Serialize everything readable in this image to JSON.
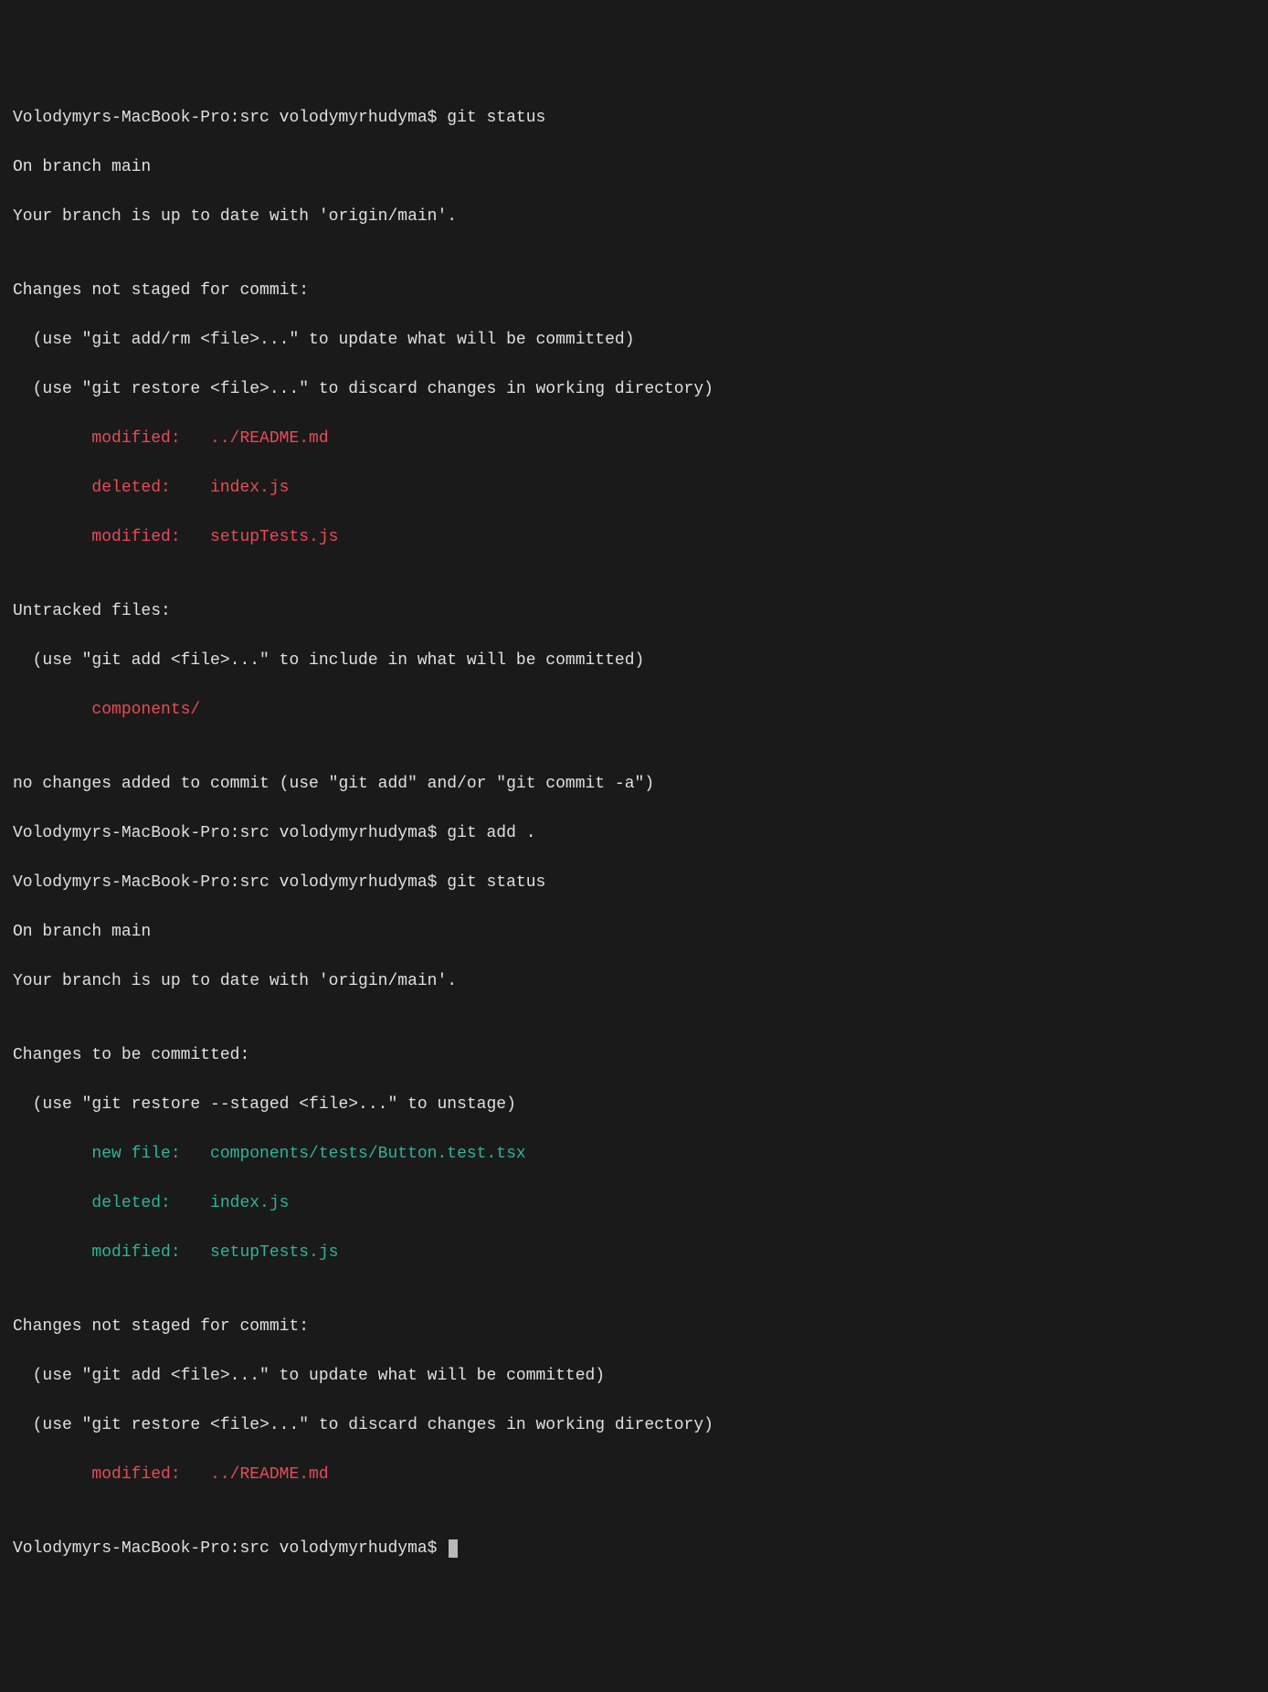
{
  "prompt": "Volodymyrs-MacBook-Pro:src volodymyrhudyma$ ",
  "cmd1": "git status",
  "branch_line": "On branch main",
  "uptodate_line": "Your branch is up to date with 'origin/main'.",
  "blank": "",
  "unstaged_header": "Changes not staged for commit:",
  "unstaged_hint1": "  (use \"git add/rm <file>...\" to update what will be committed)",
  "unstaged_hint2": "  (use \"git restore <file>...\" to discard changes in working directory)",
  "unstaged_files": {
    "f1": "        modified:   ../README.md",
    "f2": "        deleted:    index.js",
    "f3": "        modified:   setupTests.js"
  },
  "untracked_header": "Untracked files:",
  "untracked_hint": "  (use \"git add <file>...\" to include in what will be committed)",
  "untracked_files": {
    "f1": "        components/"
  },
  "no_changes_line": "no changes added to commit (use \"git add\" and/or \"git commit -a\")",
  "cmd2": "git add .",
  "cmd3": "git status",
  "staged_header": "Changes to be committed:",
  "staged_hint": "  (use \"git restore --staged <file>...\" to unstage)",
  "staged_files": {
    "f1": "        new file:   components/tests/Button.test.tsx",
    "f2": "        deleted:    index.js",
    "f3": "        modified:   setupTests.js"
  },
  "unstaged2_header": "Changes not staged for commit:",
  "unstaged2_hint1": "  (use \"git add <file>...\" to update what will be committed)",
  "unstaged2_hint2": "  (use \"git restore <file>...\" to discard changes in working directory)",
  "unstaged2_files": {
    "f1": "        modified:   ../README.md"
  }
}
